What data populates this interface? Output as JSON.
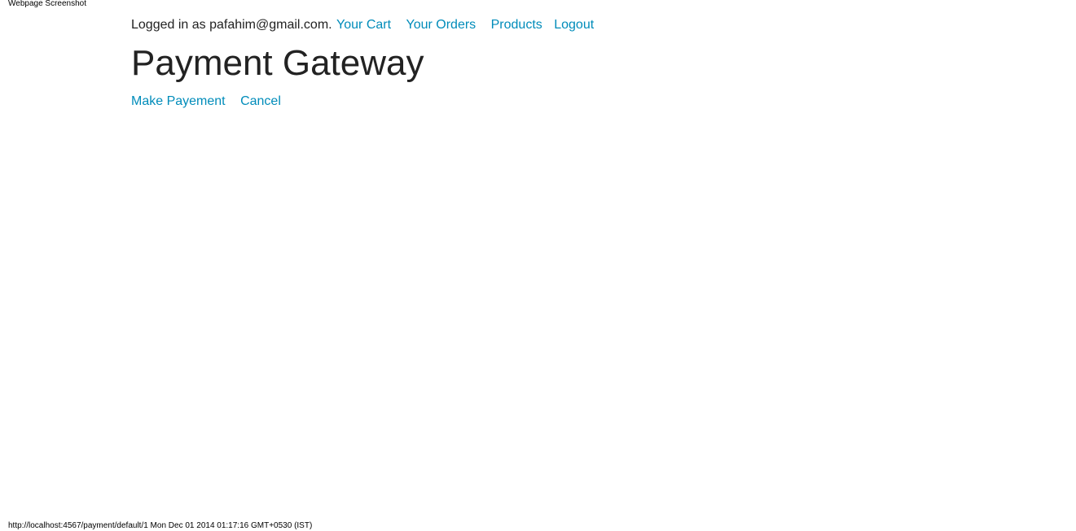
{
  "print": {
    "header": "Webpage Screenshot",
    "footer": "http://localhost:4567/payment/default/1 Mon Dec 01 2014 01:17:16 GMT+0530 (IST)"
  },
  "nav": {
    "logged_in_text": "Logged in as pafahim@gmail.com.",
    "links": {
      "cart": "Your Cart",
      "orders": "Your Orders",
      "products": "Products",
      "logout": "Logout"
    }
  },
  "main": {
    "title": "Payment Gateway",
    "actions": {
      "make_payment": "Make Payement",
      "cancel": "Cancel"
    }
  },
  "colors": {
    "link": "#008cba",
    "text": "#222222",
    "background": "#ffffff"
  }
}
